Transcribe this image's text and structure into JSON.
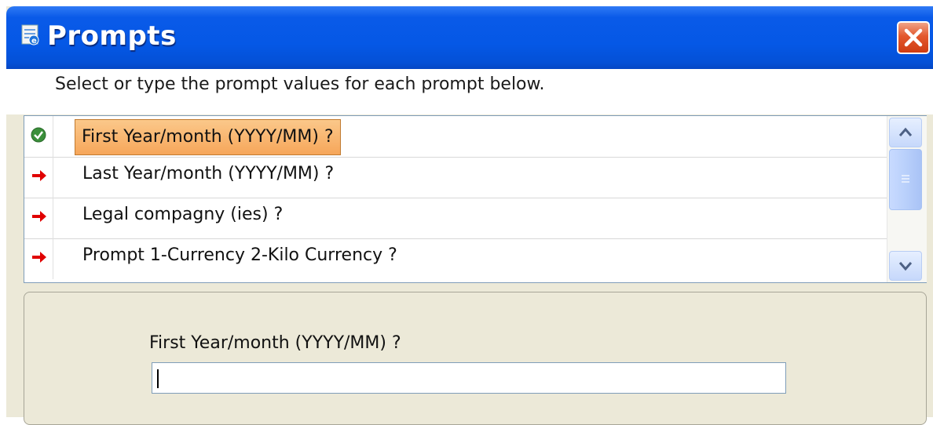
{
  "window": {
    "title": "Prompts",
    "title_icon": "ie-icon",
    "close_icon": "close-icon"
  },
  "instruction": "Select or type the prompt values for each prompt below.",
  "prompts": [
    {
      "label": "First Year/month (YYYY/MM) ?",
      "status": "answered",
      "status_icon": "checkmark-icon",
      "selected": true
    },
    {
      "label": "Last Year/month (YYYY/MM) ?",
      "status": "required",
      "status_icon": "red-arrow-icon",
      "selected": false
    },
    {
      "label": "Legal compagny (ies) ?",
      "status": "required",
      "status_icon": "red-arrow-icon",
      "selected": false
    },
    {
      "label": "Prompt 1-Currency 2-Kilo Currency ?",
      "status": "required",
      "status_icon": "red-arrow-icon",
      "selected": false
    }
  ],
  "scrollbar": {
    "up_icon": "chevron-up-icon",
    "down_icon": "chevron-down-icon"
  },
  "detail": {
    "field_label": "First Year/month  (YYYY/MM) ?",
    "field_value": ""
  },
  "colors": {
    "titlebar": "#0558e6",
    "selection": "#f6a65a",
    "arrow": "#e00000",
    "check": "#3a8f3a"
  }
}
